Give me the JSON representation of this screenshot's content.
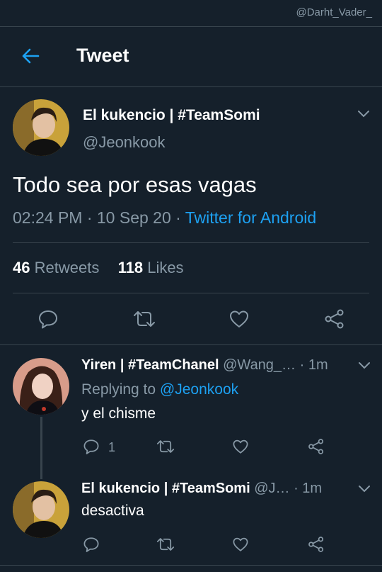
{
  "watermark": "@Darht_Vader_",
  "header": {
    "title": "Tweet"
  },
  "tweet": {
    "author_name": "El kukencio | #TeamSomi",
    "author_handle": "@Jeonkook",
    "text": "Todo sea por esas vagas",
    "time": "02:24 PM · 10 Sep 20 · ",
    "source": "Twitter for Android",
    "retweets_count": "46",
    "retweets_label": "Retweets",
    "likes_count": "118",
    "likes_label": "Likes"
  },
  "replies": [
    {
      "name": "Yiren | #TeamChanel",
      "handle": "@Wang_…",
      "time": "· 1m",
      "replying_prefix": "Replying to ",
      "replying_handle": "@Jeonkook",
      "text": "y el chisme",
      "reply_count": "1"
    },
    {
      "name": "El kukencio | #TeamSomi",
      "handle": "@J…",
      "time": "· 1m",
      "text": "desactiva"
    }
  ],
  "colors": {
    "background": "#15202b",
    "accent": "#1da1f2",
    "muted": "#8899a6",
    "divider": "#38444d"
  },
  "icons": [
    "back-arrow-icon",
    "chevron-down-icon",
    "reply-icon",
    "retweet-icon",
    "like-icon",
    "share-icon"
  ]
}
